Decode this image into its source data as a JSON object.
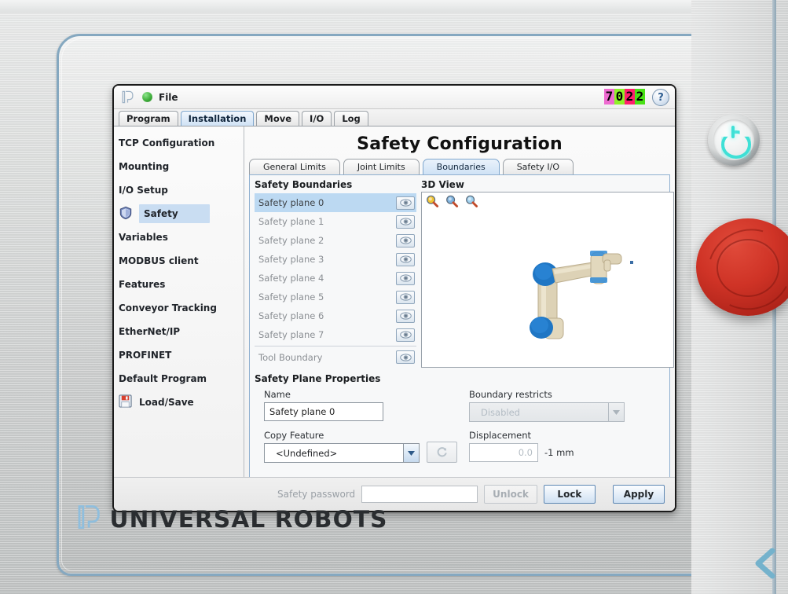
{
  "device": {
    "brand_text": "UNIVERSAL ROBOTS",
    "brand_logo_icon": "ur-logo-icon",
    "power_button_icon": "power-icon",
    "emergency_stop_icon": "emergency-stop-icon",
    "collapse_chevron_icon": "chevron-left-icon",
    "accent_color": "#85a8c0",
    "power_glow_color": "#3fe0d6",
    "estop_color": "#cf3326"
  },
  "topbar": {
    "logo_icon": "ur-logo-icon",
    "status_icon": "green-status-icon",
    "file_label": "File",
    "help_icon": "help-icon",
    "number_display": {
      "digits": [
        "7",
        "0",
        "2",
        "2"
      ],
      "backgrounds": [
        "#ee6ad0",
        "#8ef028",
        "#ff1f6e",
        "#49e015"
      ]
    }
  },
  "main_tabs": [
    {
      "label": "Program",
      "active": false
    },
    {
      "label": "Installation",
      "active": true
    },
    {
      "label": "Move",
      "active": false
    },
    {
      "label": "I/O",
      "active": false
    },
    {
      "label": "Log",
      "active": false
    }
  ],
  "sidebar": {
    "items": [
      {
        "label": "TCP Configuration",
        "icon": "",
        "selected": false
      },
      {
        "label": "Mounting",
        "icon": "",
        "selected": false
      },
      {
        "label": "I/O Setup",
        "icon": "",
        "selected": false
      },
      {
        "label": "Safety",
        "icon": "shield-icon",
        "selected": true
      },
      {
        "label": "Variables",
        "icon": "",
        "selected": false
      },
      {
        "label": "MODBUS client",
        "icon": "",
        "selected": false
      },
      {
        "label": "Features",
        "icon": "",
        "selected": false
      },
      {
        "label": "Conveyor Tracking",
        "icon": "",
        "selected": false
      },
      {
        "label": "EtherNet/IP",
        "icon": "",
        "selected": false
      },
      {
        "label": "PROFINET",
        "icon": "",
        "selected": false
      },
      {
        "label": "Default Program",
        "icon": "",
        "selected": false
      },
      {
        "label": "Load/Save",
        "icon": "floppy-disk-icon",
        "selected": false
      }
    ]
  },
  "content": {
    "page_title": "Safety Configuration",
    "sub_tabs": [
      {
        "label": "General Limits",
        "active": false
      },
      {
        "label": "Joint Limits",
        "active": false
      },
      {
        "label": "Boundaries",
        "active": true
      },
      {
        "label": "Safety I/O",
        "active": false
      }
    ],
    "boundaries": {
      "group_title": "Safety Boundaries",
      "visibility_icon": "eye-icon",
      "items": [
        {
          "label": "Safety plane 0",
          "selected": true,
          "divider": false
        },
        {
          "label": "Safety plane 1",
          "selected": false,
          "divider": false
        },
        {
          "label": "Safety plane 2",
          "selected": false,
          "divider": false
        },
        {
          "label": "Safety plane 3",
          "selected": false,
          "divider": false
        },
        {
          "label": "Safety plane 4",
          "selected": false,
          "divider": false
        },
        {
          "label": "Safety plane 5",
          "selected": false,
          "divider": false
        },
        {
          "label": "Safety plane 6",
          "selected": false,
          "divider": false
        },
        {
          "label": "Safety plane 7",
          "selected": false,
          "divider": false
        },
        {
          "label": "Tool Boundary",
          "selected": false,
          "divider": true
        }
      ]
    },
    "view3d": {
      "group_title": "3D View",
      "tools": [
        {
          "icon": "zoom-in-icon"
        },
        {
          "icon": "zoom-out-icon"
        },
        {
          "icon": "zoom-fit-icon"
        }
      ],
      "robot_model_icon": "robot-arm-model"
    },
    "properties": {
      "group_title": "Safety Plane Properties",
      "name_label": "Name",
      "name_value": "Safety plane 0",
      "copy_feature_label": "Copy Feature",
      "copy_feature_value": "<Undefined>",
      "refresh_icon": "refresh-icon",
      "dropdown_icon": "chevron-down-icon",
      "boundary_restricts_label": "Boundary restricts",
      "boundary_restricts_value": "Disabled",
      "displacement_label": "Displacement",
      "displacement_value": "0.0",
      "displacement_unit": "-1 mm"
    }
  },
  "bottombar": {
    "password_label": "Safety password",
    "password_value": "",
    "password_placeholder": "",
    "unlock_label": "Unlock",
    "lock_label": "Lock",
    "apply_label": "Apply"
  }
}
